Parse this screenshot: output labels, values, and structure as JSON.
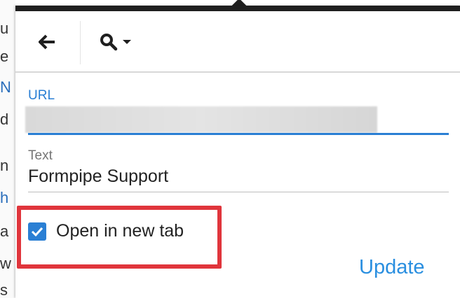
{
  "toolbar": {
    "back_icon": "arrow-left-icon",
    "search_icon": "search-icon",
    "dropdown_icon": "caret-down-icon"
  },
  "url_field": {
    "label": "URL",
    "accent_color": "#2a7fd4"
  },
  "text_field": {
    "label": "Text",
    "value": "Formpipe Support"
  },
  "open_new_tab": {
    "label": "Open in new tab",
    "checked": true
  },
  "update_button": {
    "label": "Update"
  },
  "highlight_color": "#e0353c"
}
